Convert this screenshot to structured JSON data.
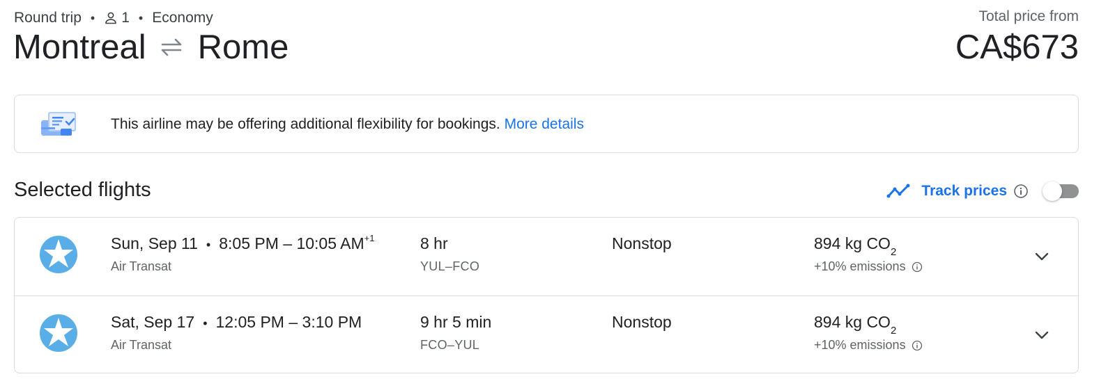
{
  "header": {
    "trip_type": "Round trip",
    "passengers": "1",
    "cabin": "Economy",
    "origin": "Montreal",
    "destination": "Rome",
    "price_label": "Total price from",
    "price": "CA$673"
  },
  "banner": {
    "text": "This airline may be offering additional flexibility for bookings. ",
    "link": "More details"
  },
  "selected": {
    "title": "Selected flights",
    "track_label": "Track prices",
    "track_enabled": false
  },
  "flights": [
    {
      "date": "Sun, Sep 11",
      "times": "8:05 PM – 10:05 AM",
      "day_offset": "+1",
      "airline": "Air Transat",
      "duration": "8 hr",
      "route": "YUL–FCO",
      "stops": "Nonstop",
      "co2": "894 kg CO",
      "co2_sub": "2",
      "emissions": "+10% emissions"
    },
    {
      "date": "Sat, Sep 17",
      "times": "12:05 PM – 3:10 PM",
      "day_offset": "",
      "airline": "Air Transat",
      "duration": "9 hr 5 min",
      "route": "FCO–YUL",
      "stops": "Nonstop",
      "co2": "894 kg CO",
      "co2_sub": "2",
      "emissions": "+10% emissions"
    }
  ],
  "colors": {
    "link": "#1a73e8",
    "airline_logo": "#5aaee8",
    "border": "#dadce0"
  },
  "icons": {
    "person": "person-icon",
    "swap": "swap-arrows-icon",
    "banner": "flexible-booking-icon",
    "trend": "trend-line-icon",
    "info": "info-icon",
    "airline": "air-transat-logo",
    "expand": "chevron-down-icon"
  }
}
